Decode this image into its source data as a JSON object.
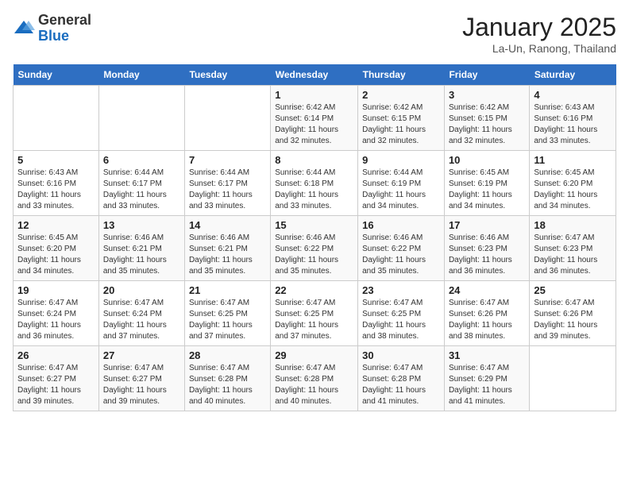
{
  "header": {
    "logo_general": "General",
    "logo_blue": "Blue",
    "month_title": "January 2025",
    "subtitle": "La-Un, Ranong, Thailand"
  },
  "weekdays": [
    "Sunday",
    "Monday",
    "Tuesday",
    "Wednesday",
    "Thursday",
    "Friday",
    "Saturday"
  ],
  "weeks": [
    [
      {
        "day": "",
        "info": ""
      },
      {
        "day": "",
        "info": ""
      },
      {
        "day": "",
        "info": ""
      },
      {
        "day": "1",
        "info": "Sunrise: 6:42 AM\nSunset: 6:14 PM\nDaylight: 11 hours\nand 32 minutes."
      },
      {
        "day": "2",
        "info": "Sunrise: 6:42 AM\nSunset: 6:15 PM\nDaylight: 11 hours\nand 32 minutes."
      },
      {
        "day": "3",
        "info": "Sunrise: 6:42 AM\nSunset: 6:15 PM\nDaylight: 11 hours\nand 32 minutes."
      },
      {
        "day": "4",
        "info": "Sunrise: 6:43 AM\nSunset: 6:16 PM\nDaylight: 11 hours\nand 33 minutes."
      }
    ],
    [
      {
        "day": "5",
        "info": "Sunrise: 6:43 AM\nSunset: 6:16 PM\nDaylight: 11 hours\nand 33 minutes."
      },
      {
        "day": "6",
        "info": "Sunrise: 6:44 AM\nSunset: 6:17 PM\nDaylight: 11 hours\nand 33 minutes."
      },
      {
        "day": "7",
        "info": "Sunrise: 6:44 AM\nSunset: 6:17 PM\nDaylight: 11 hours\nand 33 minutes."
      },
      {
        "day": "8",
        "info": "Sunrise: 6:44 AM\nSunset: 6:18 PM\nDaylight: 11 hours\nand 33 minutes."
      },
      {
        "day": "9",
        "info": "Sunrise: 6:44 AM\nSunset: 6:19 PM\nDaylight: 11 hours\nand 34 minutes."
      },
      {
        "day": "10",
        "info": "Sunrise: 6:45 AM\nSunset: 6:19 PM\nDaylight: 11 hours\nand 34 minutes."
      },
      {
        "day": "11",
        "info": "Sunrise: 6:45 AM\nSunset: 6:20 PM\nDaylight: 11 hours\nand 34 minutes."
      }
    ],
    [
      {
        "day": "12",
        "info": "Sunrise: 6:45 AM\nSunset: 6:20 PM\nDaylight: 11 hours\nand 34 minutes."
      },
      {
        "day": "13",
        "info": "Sunrise: 6:46 AM\nSunset: 6:21 PM\nDaylight: 11 hours\nand 35 minutes."
      },
      {
        "day": "14",
        "info": "Sunrise: 6:46 AM\nSunset: 6:21 PM\nDaylight: 11 hours\nand 35 minutes."
      },
      {
        "day": "15",
        "info": "Sunrise: 6:46 AM\nSunset: 6:22 PM\nDaylight: 11 hours\nand 35 minutes."
      },
      {
        "day": "16",
        "info": "Sunrise: 6:46 AM\nSunset: 6:22 PM\nDaylight: 11 hours\nand 35 minutes."
      },
      {
        "day": "17",
        "info": "Sunrise: 6:46 AM\nSunset: 6:23 PM\nDaylight: 11 hours\nand 36 minutes."
      },
      {
        "day": "18",
        "info": "Sunrise: 6:47 AM\nSunset: 6:23 PM\nDaylight: 11 hours\nand 36 minutes."
      }
    ],
    [
      {
        "day": "19",
        "info": "Sunrise: 6:47 AM\nSunset: 6:24 PM\nDaylight: 11 hours\nand 36 minutes."
      },
      {
        "day": "20",
        "info": "Sunrise: 6:47 AM\nSunset: 6:24 PM\nDaylight: 11 hours\nand 37 minutes."
      },
      {
        "day": "21",
        "info": "Sunrise: 6:47 AM\nSunset: 6:25 PM\nDaylight: 11 hours\nand 37 minutes."
      },
      {
        "day": "22",
        "info": "Sunrise: 6:47 AM\nSunset: 6:25 PM\nDaylight: 11 hours\nand 37 minutes."
      },
      {
        "day": "23",
        "info": "Sunrise: 6:47 AM\nSunset: 6:25 PM\nDaylight: 11 hours\nand 38 minutes."
      },
      {
        "day": "24",
        "info": "Sunrise: 6:47 AM\nSunset: 6:26 PM\nDaylight: 11 hours\nand 38 minutes."
      },
      {
        "day": "25",
        "info": "Sunrise: 6:47 AM\nSunset: 6:26 PM\nDaylight: 11 hours\nand 39 minutes."
      }
    ],
    [
      {
        "day": "26",
        "info": "Sunrise: 6:47 AM\nSunset: 6:27 PM\nDaylight: 11 hours\nand 39 minutes."
      },
      {
        "day": "27",
        "info": "Sunrise: 6:47 AM\nSunset: 6:27 PM\nDaylight: 11 hours\nand 39 minutes."
      },
      {
        "day": "28",
        "info": "Sunrise: 6:47 AM\nSunset: 6:28 PM\nDaylight: 11 hours\nand 40 minutes."
      },
      {
        "day": "29",
        "info": "Sunrise: 6:47 AM\nSunset: 6:28 PM\nDaylight: 11 hours\nand 40 minutes."
      },
      {
        "day": "30",
        "info": "Sunrise: 6:47 AM\nSunset: 6:28 PM\nDaylight: 11 hours\nand 41 minutes."
      },
      {
        "day": "31",
        "info": "Sunrise: 6:47 AM\nSunset: 6:29 PM\nDaylight: 11 hours\nand 41 minutes."
      },
      {
        "day": "",
        "info": ""
      }
    ]
  ]
}
